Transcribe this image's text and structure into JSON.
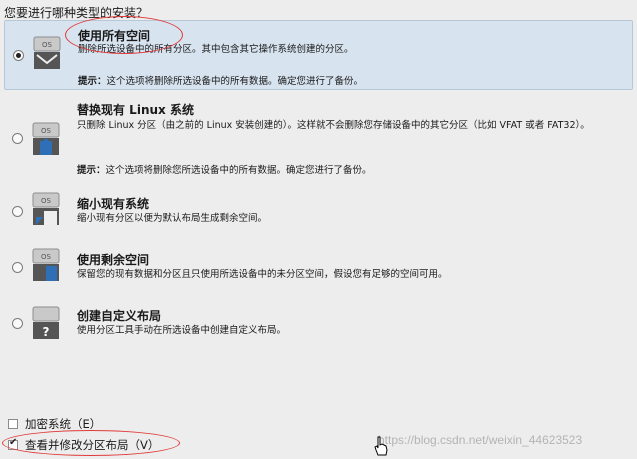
{
  "question": "您要进行哪种类型的安装？",
  "icon_label": "OS",
  "custom_icon_glyph": "?",
  "options": [
    {
      "title": "使用所有空间",
      "desc": "删除所选设备中的所有分区。其中包含其它操作系统创建的分区。",
      "tip_label": "提示：",
      "tip": "这个选项将删除所选设备中的所有数据。确定您进行了备份。",
      "selected": true
    },
    {
      "title": "替换现有 Linux 系统",
      "desc": "只删除 Linux 分区（由之前的 Linux 安装创建的）。这样就不会删除您存储设备中的其它分区（比如 VFAT 或者 FAT32）。",
      "tip_label": "提示：",
      "tip": "这个选项将删除您所选设备中的所有数据。确定您进行了备份。",
      "selected": false
    },
    {
      "title": "缩小现有系统",
      "desc": "缩小现有分区以便为默认布局生成剩余空间。",
      "selected": false
    },
    {
      "title": "使用剩余空间",
      "desc": "保留您的现有数据和分区且只使用所选设备中的未分区空间，假设您有足够的空间可用。",
      "selected": false
    },
    {
      "title": "创建自定义布局",
      "desc": "使用分区工具手动在所选设备中创建自定义布局。",
      "selected": false
    }
  ],
  "checkboxes": {
    "encrypt": {
      "label": "加密系统（E）",
      "checked": false
    },
    "review": {
      "label": "查看并修改分区布局（V）",
      "checked": true
    }
  },
  "watermark": "https://blog.csdn.net/weixin_44623523",
  "colors": {
    "selected_bg": "#d7e3ef",
    "annotation": "#e03a3a",
    "icon_blue": "#2f6fb5"
  }
}
